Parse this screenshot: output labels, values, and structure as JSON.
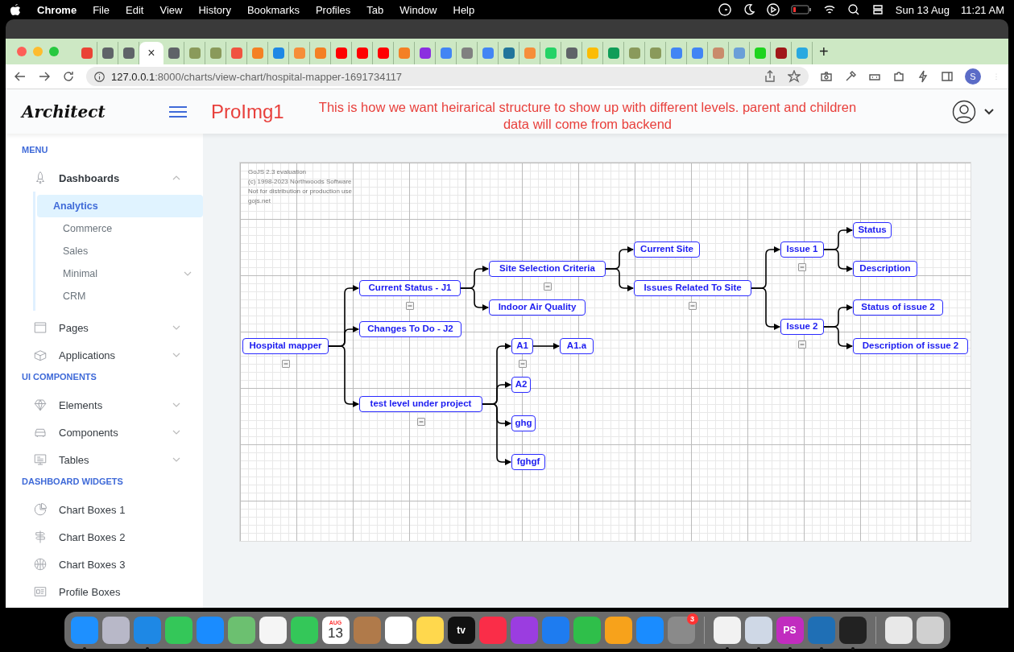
{
  "menubar": {
    "app": "Chrome",
    "menus": [
      "File",
      "Edit",
      "View",
      "History",
      "Bookmarks",
      "Profiles",
      "Tab",
      "Window",
      "Help"
    ],
    "date": "Sun 13 Aug",
    "time": "11:21 AM"
  },
  "browser": {
    "tabs": [
      {
        "selected": false,
        "color": "#ea4335"
      },
      {
        "selected": false,
        "color": "#5f6368"
      },
      {
        "selected": false,
        "color": "#5f6368"
      },
      {
        "selected": true,
        "close": "×"
      },
      {
        "selected": false,
        "color": "#5f6368"
      },
      {
        "selected": false,
        "color": "#8a9a5b"
      },
      {
        "selected": false,
        "color": "#8a9a5b"
      },
      {
        "selected": false,
        "color": "#f05340"
      },
      {
        "selected": false,
        "color": "#f48024"
      },
      {
        "selected": false,
        "color": "#1e88e5"
      },
      {
        "selected": false,
        "color": "#f68e3a"
      },
      {
        "selected": false,
        "color": "#f48024"
      },
      {
        "selected": false,
        "color": "#ff0000"
      },
      {
        "selected": false,
        "color": "#ff0000"
      },
      {
        "selected": false,
        "color": "#ff0000"
      },
      {
        "selected": false,
        "color": "#f48024"
      },
      {
        "selected": false,
        "color": "#8b2fe0"
      },
      {
        "selected": false,
        "color": "#4285f4"
      },
      {
        "selected": false,
        "color": "#808080"
      },
      {
        "selected": false,
        "color": "#4285f4"
      },
      {
        "selected": false,
        "color": "#21759b"
      },
      {
        "selected": false,
        "color": "#f68e3a"
      },
      {
        "selected": false,
        "color": "#25d366"
      },
      {
        "selected": false,
        "color": "#5f6368"
      },
      {
        "selected": false,
        "color": "#fbbc04"
      },
      {
        "selected": false,
        "color": "#0f9d58"
      },
      {
        "selected": false,
        "color": "#8a9a5b"
      },
      {
        "selected": false,
        "color": "#8a9a5b"
      },
      {
        "selected": false,
        "color": "#4285f4"
      },
      {
        "selected": false,
        "color": "#4285f4"
      },
      {
        "selected": false,
        "color": "#c98b6b"
      },
      {
        "selected": false,
        "color": "#6a9fd8"
      },
      {
        "selected": false,
        "color": "#1ed41e"
      },
      {
        "selected": false,
        "color": "#a01818"
      },
      {
        "selected": false,
        "color": "#29a9e0"
      }
    ],
    "new_tab": "+",
    "url_host": "127.0.0.1",
    "url_rest": ":8000/charts/view-chart/hospital-mapper-1691734117",
    "profile": "S"
  },
  "header": {
    "logo": "Architect",
    "page_title": "ProImg1",
    "note": "This is how we want heirarical structure to show up with different levels. parent and children data will come from backend"
  },
  "sidebar": {
    "sections": [
      {
        "title": "MENU",
        "items": [
          {
            "label": "Dashboards",
            "selected": false,
            "expanded": true,
            "children": [
              {
                "label": "Analytics",
                "selected": true
              },
              {
                "label": "Commerce",
                "selected": false
              },
              {
                "label": "Sales",
                "selected": false
              },
              {
                "label": "Minimal",
                "selected": false,
                "expanded": false
              },
              {
                "label": "CRM",
                "selected": false
              }
            ]
          },
          {
            "label": "Pages",
            "selected": false,
            "expanded": false
          },
          {
            "label": "Applications",
            "selected": false,
            "expanded": false
          }
        ]
      },
      {
        "title": "UI COMPONENTS",
        "items": [
          {
            "label": "Elements",
            "selected": false,
            "expanded": false
          },
          {
            "label": "Components",
            "selected": false,
            "expanded": false
          },
          {
            "label": "Tables",
            "selected": false,
            "expanded": false
          }
        ]
      },
      {
        "title": "DASHBOARD WIDGETS",
        "items": [
          {
            "label": "Chart Boxes 1",
            "selected": false
          },
          {
            "label": "Chart Boxes 2",
            "selected": false
          },
          {
            "label": "Chart Boxes 3",
            "selected": false
          },
          {
            "label": "Profile Boxes",
            "selected": false
          }
        ]
      }
    ]
  },
  "diagram": {
    "watermark": [
      "GoJS 2.3 evaluation",
      "(c) 1998-2023 Northwoods Software",
      "Not for distribution or production use",
      "gojs.net"
    ],
    "root": {
      "label": "Hospital mapper",
      "expanded": true,
      "children": [
        {
          "label": "Current Status - J1",
          "expanded": true,
          "children": [
            {
              "label": "Site Selection Criteria",
              "expanded": true,
              "children": [
                {
                  "label": "Current Site"
                },
                {
                  "label": "Issues Related To Site",
                  "expanded": true,
                  "children": [
                    {
                      "label": "Issue 1",
                      "expanded": true,
                      "children": [
                        {
                          "label": "Status"
                        },
                        {
                          "label": "Description"
                        }
                      ]
                    },
                    {
                      "label": "Issue 2",
                      "expanded": true,
                      "children": [
                        {
                          "label": "Status of issue 2"
                        },
                        {
                          "label": "Description of issue 2"
                        }
                      ]
                    }
                  ]
                }
              ]
            },
            {
              "label": "Indoor Air Quality"
            }
          ]
        },
        {
          "label": "Changes To Do - J2"
        },
        {
          "label": "test level under project",
          "expanded": true,
          "children": [
            {
              "label": "A1",
              "expanded": true,
              "children": [
                {
                  "label": "A1.a"
                }
              ]
            },
            {
              "label": "A2"
            },
            {
              "label": "ghg"
            },
            {
              "label": "fghgf"
            }
          ]
        }
      ]
    }
  },
  "dock": [
    {
      "kind": "app",
      "color": "#1e90ff",
      "running": true
    },
    {
      "kind": "app",
      "color": "#b8b8c8",
      "running": false
    },
    {
      "kind": "app",
      "color": "#1e88e5",
      "running": true
    },
    {
      "kind": "app",
      "color": "#34c759",
      "running": false
    },
    {
      "kind": "app",
      "color": "#1a8cff",
      "running": false
    },
    {
      "kind": "app",
      "color": "#6cc070",
      "running": false
    },
    {
      "kind": "app",
      "color": "#f5f5f5",
      "running": false
    },
    {
      "kind": "app",
      "color": "#34c759",
      "running": false
    },
    {
      "kind": "calendar",
      "color": "#ffffff",
      "month": "AUG",
      "day": "13",
      "running": false
    },
    {
      "kind": "app",
      "color": "#b07a4a",
      "running": false
    },
    {
      "kind": "app",
      "color": "#ffffff",
      "running": false
    },
    {
      "kind": "app",
      "color": "#ffd84d",
      "running": false
    },
    {
      "kind": "app",
      "color": "#111111",
      "label": "tv",
      "running": false
    },
    {
      "kind": "app",
      "color": "#fa2d48",
      "running": false
    },
    {
      "kind": "app",
      "color": "#9b3de0",
      "running": false
    },
    {
      "kind": "app",
      "color": "#1e7cf0",
      "running": false
    },
    {
      "kind": "app",
      "color": "#2fbf4a",
      "running": false
    },
    {
      "kind": "app",
      "color": "#f7a21b",
      "running": false
    },
    {
      "kind": "app",
      "color": "#1a8cff",
      "running": false
    },
    {
      "kind": "app",
      "color": "#8a8a8a",
      "badge": "3",
      "running": false
    },
    {
      "kind": "separator"
    },
    {
      "kind": "app",
      "color": "#f2f2f2",
      "running": true
    },
    {
      "kind": "app",
      "color": "#cfd8e6",
      "running": true
    },
    {
      "kind": "app",
      "color": "#c12cbf",
      "label": "PS",
      "running": true
    },
    {
      "kind": "app",
      "color": "#1f6fb5",
      "running": true
    },
    {
      "kind": "app",
      "color": "#222222",
      "running": true
    },
    {
      "kind": "separator"
    },
    {
      "kind": "app",
      "color": "#e8e8e8",
      "running": false
    },
    {
      "kind": "app",
      "color": "#d0d0d0",
      "running": false
    }
  ]
}
